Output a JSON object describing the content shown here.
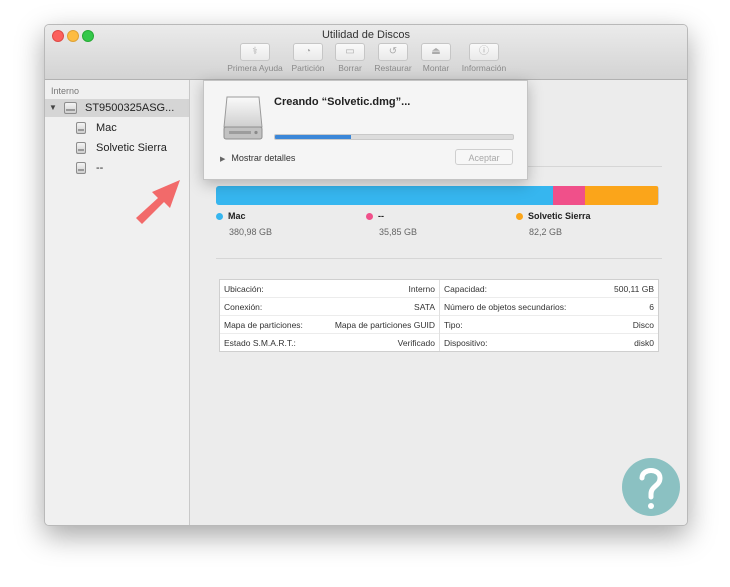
{
  "window": {
    "title": "Utilidad de Discos"
  },
  "toolbar": {
    "buttons": [
      {
        "label": "Primera Ayuda",
        "icon": "stethoscope-icon"
      },
      {
        "label": "Partición",
        "icon": "partition-icon"
      },
      {
        "label": "Borrar",
        "icon": "erase-icon"
      },
      {
        "label": "Restaurar",
        "icon": "restore-icon"
      },
      {
        "label": "Montar",
        "icon": "mount-icon"
      },
      {
        "label": "Información",
        "icon": "info-icon"
      }
    ]
  },
  "sidebar": {
    "heading": "Interno",
    "disk": {
      "label": "ST9500325ASG...",
      "icon": "hard-drive-icon"
    },
    "volumes": [
      {
        "label": "Mac",
        "icon": "volume-icon"
      },
      {
        "label": "Solvetic Sierra",
        "icon": "volume-icon"
      },
      {
        "label": "--",
        "icon": "volume-icon"
      }
    ]
  },
  "usage": {
    "segments": [
      {
        "name": "Mac",
        "size": "380,98 GB",
        "color": "#36b6ef",
        "fraction": 0.7614
      },
      {
        "name": "--",
        "size": "35,85 GB",
        "color": "#f0508a",
        "fraction": 0.0716
      },
      {
        "name": "Solvetic Sierra",
        "size": "82,2 GB",
        "color": "#fba51a",
        "fraction": 0.1643
      }
    ]
  },
  "info": {
    "left": [
      {
        "label": "Ubicación:",
        "value": "Interno"
      },
      {
        "label": "Conexión:",
        "value": "SATA"
      },
      {
        "label": "Mapa de particiones:",
        "value": "Mapa de particiones GUID"
      },
      {
        "label": "Estado S.M.A.R.T.:",
        "value": "Verificado"
      }
    ],
    "right": [
      {
        "label": "Capacidad:",
        "value": "500,11 GB"
      },
      {
        "label": "Número de objetos secundarios:",
        "value": "6"
      },
      {
        "label": "Tipo:",
        "value": "Disco"
      },
      {
        "label": "Dispositivo:",
        "value": "disk0"
      }
    ]
  },
  "sheet": {
    "title": "Creando “Solvetic.dmg”...",
    "progress": 0.32,
    "details_label": "Mostrar detalles",
    "accept_label": "Aceptar"
  },
  "colors": {
    "arrow": "#f26a6a",
    "logo": "#3d9fa0",
    "progress": "#3b87d8"
  }
}
